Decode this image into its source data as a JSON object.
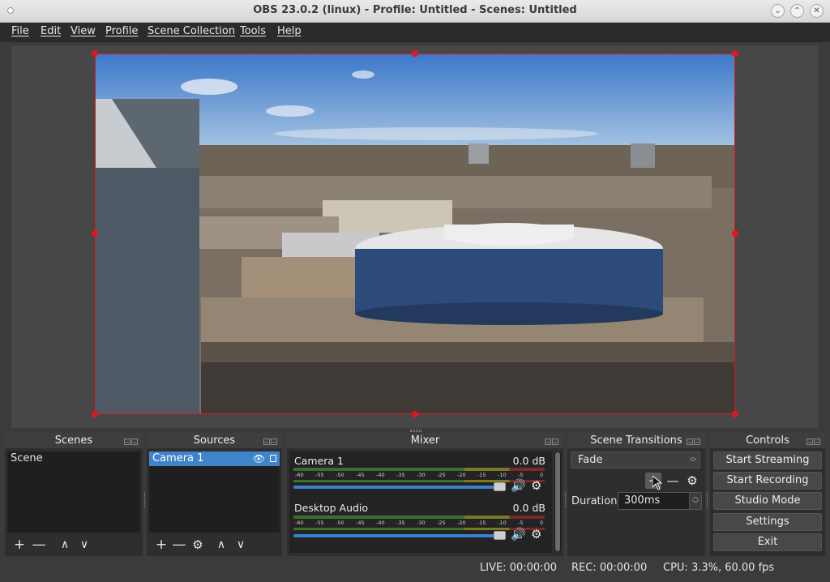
{
  "window": {
    "title": "OBS 23.0.2 (linux) - Profile: Untitled - Scenes: Untitled",
    "btn_minimize": "⌄",
    "btn_maximize": "⌃",
    "btn_close": "✕"
  },
  "menu": [
    "File",
    "Edit",
    "View",
    "Profile",
    "Scene Collection",
    "Tools",
    "Help"
  ],
  "preview": {
    "source_image": "aerial city view with circular building",
    "border_color": "#e0171e"
  },
  "scenes": {
    "title": "Scenes",
    "items": [
      "Scene"
    ]
  },
  "sources": {
    "title": "Sources",
    "items": [
      "Camera 1"
    ]
  },
  "mixer": {
    "title": "Mixer",
    "channels": [
      {
        "name": "Camera 1",
        "db": "0.0 dB",
        "volume": 1.0
      },
      {
        "name": "Desktop Audio",
        "db": "0.0 dB",
        "volume": 1.0
      }
    ],
    "scale": [
      "-60",
      "-55",
      "-50",
      "-45",
      "-40",
      "-35",
      "-30",
      "-25",
      "-20",
      "-15",
      "-10",
      "-5",
      "0"
    ]
  },
  "transitions": {
    "title": "Scene Transitions",
    "selected": "Fade",
    "duration_label": "Duration",
    "duration_value": "300ms"
  },
  "controls": {
    "title": "Controls",
    "buttons": [
      "Start Streaming",
      "Start Recording",
      "Studio Mode",
      "Settings",
      "Exit"
    ]
  },
  "status": {
    "live": "LIVE: 00:00:00",
    "rec": "REC: 00:00:00",
    "cpu": "CPU: 3.3%, 60.00 fps"
  },
  "colors": {
    "accent": "#3f83c9",
    "selection_border": "#e0171e",
    "panel": "#2e2e2e"
  }
}
